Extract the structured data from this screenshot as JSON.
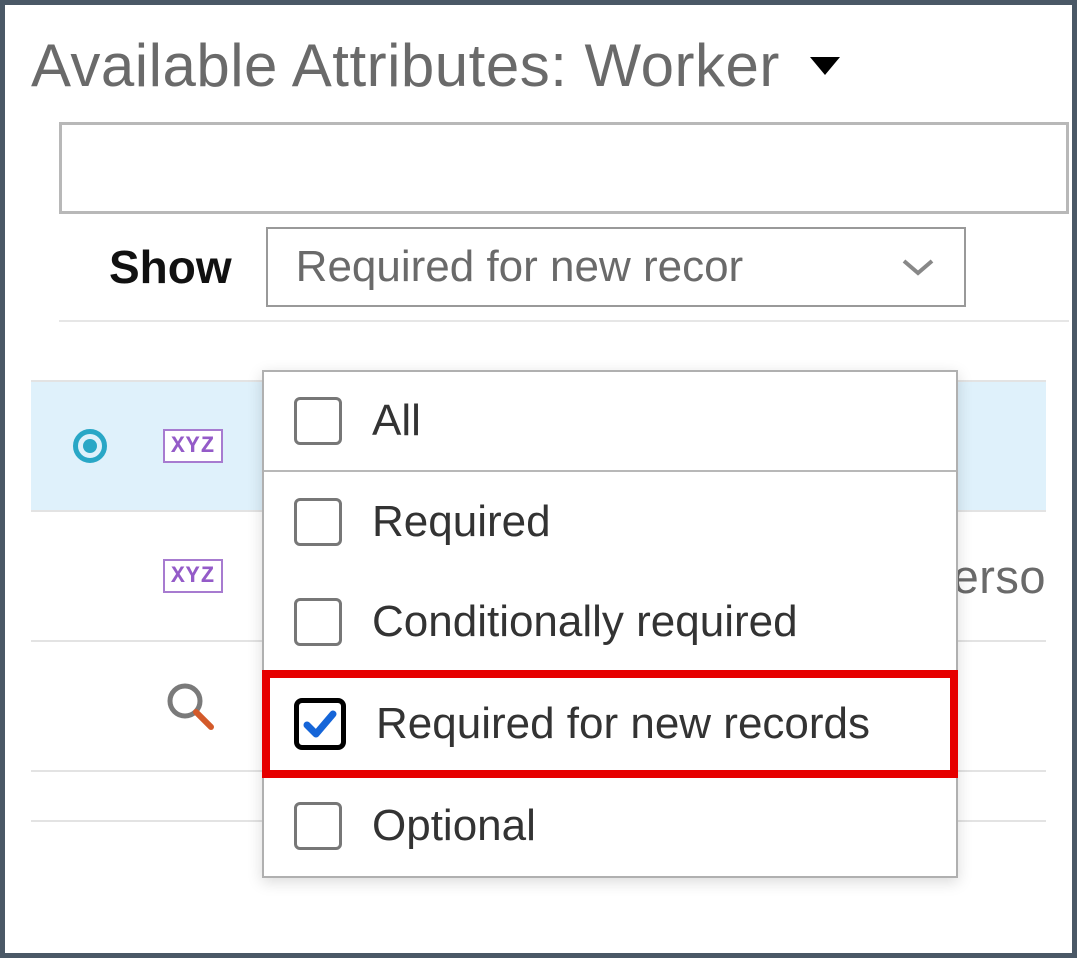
{
  "panel": {
    "title": "Available Attributes: Worker"
  },
  "filter": {
    "show_label": "Show",
    "selected_display": "Required for new recor",
    "options": [
      {
        "label": "All",
        "checked": false,
        "divider": true,
        "highlight": false
      },
      {
        "label": "Required",
        "checked": false,
        "divider": false,
        "highlight": false
      },
      {
        "label": "Conditionally required",
        "checked": false,
        "divider": false,
        "highlight": false
      },
      {
        "label": "Required for new records",
        "checked": true,
        "divider": false,
        "highlight": true
      },
      {
        "label": "Optional",
        "checked": false,
        "divider": false,
        "highlight": false
      }
    ]
  },
  "rows": {
    "tag_label": "XYZ",
    "peek_text": "Perso"
  }
}
